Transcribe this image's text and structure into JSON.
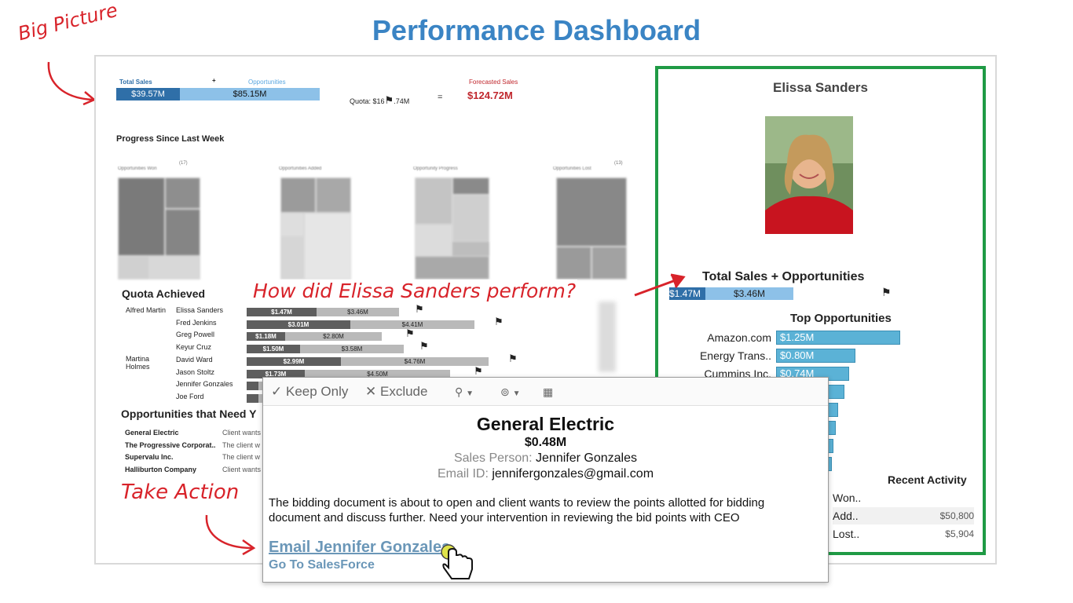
{
  "title": "Performance Dashboard",
  "annotations": {
    "big_picture": "Big Picture",
    "question": "How did Elissa Sanders perform?",
    "take_action": "Take Action"
  },
  "summary": {
    "total_sales_label": "Total Sales",
    "plus": "+",
    "opportunities_label": "Opportunities",
    "total_sales_value": "$39.57M",
    "opportunities_value": "$85.15M",
    "quota_label": "Quota: $16",
    "quota_suffix": ".74M",
    "equals": "=",
    "forecast_label": "Forecasted Sales",
    "forecast_value": "$124.72M"
  },
  "progress": {
    "title": "Progress Since Last Week",
    "panels": [
      "Opportunities Won",
      "Opportunities Added",
      "Opportunity Progress",
      "Opportunities Lost"
    ],
    "count_won": "(17)",
    "count_lost": "(13)"
  },
  "quota": {
    "title": "Quota Achieved",
    "managers": [
      "Alfred Martin",
      "Martina\nHolmes"
    ],
    "rows": [
      {
        "name": "Elissa Sanders",
        "sales": "$1.47M",
        "opp": "$3.46M",
        "sales_frac": 0.29,
        "total_frac": 0.63
      },
      {
        "name": "Fred Jenkins",
        "sales": "$3.01M",
        "opp": "$4.41M",
        "sales_frac": 0.43,
        "total_frac": 0.94
      },
      {
        "name": "Greg Powell",
        "sales": "$1.18M",
        "opp": "$2.80M",
        "sales_frac": 0.16,
        "total_frac": 0.56
      },
      {
        "name": "Keyur Cruz",
        "sales": "$1.50M",
        "opp": "$3.58M",
        "sales_frac": 0.22,
        "total_frac": 0.65
      },
      {
        "name": "David Ward",
        "sales": "$2.99M",
        "opp": "$4.76M",
        "sales_frac": 0.39,
        "total_frac": 1.0
      },
      {
        "name": "Jason Stoltz",
        "sales": "$1.73M",
        "opp": "$4.50M",
        "sales_frac": 0.24,
        "total_frac": 0.84
      },
      {
        "name": "Jennifer Gonzales",
        "sales": "",
        "opp": "",
        "sales_frac": 0.05,
        "total_frac": 0.08
      },
      {
        "name": "Joe Ford",
        "sales": "",
        "opp": "",
        "sales_frac": 0.05,
        "total_frac": 0.08
      }
    ]
  },
  "need": {
    "title": "Opportunities that Need Y",
    "rows": [
      {
        "company": "General Electric",
        "text": "Client wants"
      },
      {
        "company": "The Progressive Corporat..",
        "text": "The client w"
      },
      {
        "company": "Supervalu Inc.",
        "text": "The client w"
      },
      {
        "company": "Halliburton Company",
        "text": "Client wants"
      }
    ]
  },
  "profile": {
    "name": "Elissa Sanders",
    "ts_title": "Total Sales + Opportunities",
    "ts_sales": "$1.47M",
    "ts_opp": "$3.46M",
    "top_title": "Top Opportunities",
    "top": [
      {
        "name": "Amazon.com",
        "value": "$1.25M",
        "frac": 1.0
      },
      {
        "name": "Energy Trans..",
        "value": "$0.80M",
        "frac": 0.64
      },
      {
        "name": "Cummins Inc.",
        "value": "$0.74M",
        "frac": 0.59
      },
      {
        "name": "",
        "value": "",
        "frac": 0.55
      },
      {
        "name": "",
        "value": "",
        "frac": 0.5
      },
      {
        "name": "",
        "value": "",
        "frac": 0.48
      },
      {
        "name": "",
        "value": "",
        "frac": 0.46
      },
      {
        "name": "",
        "value": "",
        "frac": 0.45
      }
    ],
    "recent_title": "Recent Activity",
    "recent": [
      {
        "label": "Won..",
        "value": ""
      },
      {
        "label": "Add..",
        "value": "$50,800"
      },
      {
        "label": "Lost..",
        "value": "$5,904"
      }
    ]
  },
  "popup": {
    "keep_only": "Keep Only",
    "exclude": "Exclude",
    "company": "General Electric",
    "amount": "$0.48M",
    "sp_label": "Sales Person:",
    "sp_value": "Jennifer Gonzales",
    "email_label": "Email ID:",
    "email_value": "jennifergonzales@gmail.com",
    "description": "The bidding document is about to open and client wants to review the points allotted for bidding document and discuss further. Need your intervention in reviewing the bid points with CEO",
    "email_link": "Email Jennifer Gonzales",
    "salesforce_link": "Go To SalesForce"
  },
  "colors": {
    "title_blue": "#3a84c4",
    "annotation_red": "#d8232a",
    "panel_green": "#1f9a45",
    "sales_dark": "#2f6fa8",
    "opp_light": "#8dc1e8",
    "bar_teal": "#5bb2d6",
    "forecast_red": "#c0272d"
  }
}
